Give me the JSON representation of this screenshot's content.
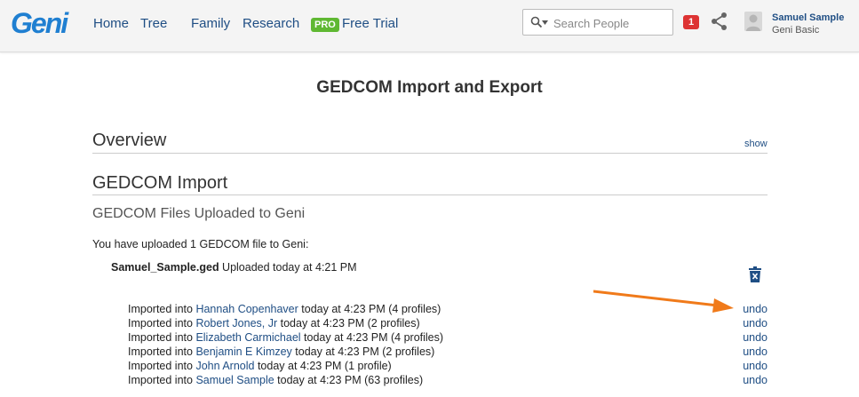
{
  "header": {
    "logo": "Geni",
    "nav": [
      {
        "label": "Home"
      },
      {
        "label": "Tree"
      },
      {
        "label": "Family"
      },
      {
        "label": "Research"
      }
    ],
    "pro_badge": "PRO",
    "free_trial": "Free Trial",
    "search_placeholder": "Search People",
    "notification_count": "1",
    "user": {
      "name": "Samuel Sample",
      "plan": "Geni Basic"
    }
  },
  "page_title": "GEDCOM Import and Export",
  "overview": {
    "heading": "Overview",
    "show_label": "show"
  },
  "import": {
    "heading": "GEDCOM Import",
    "subheading": "GEDCOM Files Uploaded to Geni",
    "uploaded_text": "You have uploaded 1 GEDCOM file to Geni:",
    "file_name": "Samuel_Sample.ged",
    "file_status": " Uploaded today at 4:21 PM",
    "rows": [
      {
        "prefix": "Imported into ",
        "profile": "Hannah Copenhaver",
        "suffix": " today at 4:23 PM (4 profiles)",
        "undo": "undo"
      },
      {
        "prefix": "Imported into ",
        "profile": "Robert Jones, Jr",
        "suffix": " today at 4:23 PM (2 profiles)",
        "undo": "undo"
      },
      {
        "prefix": "Imported into ",
        "profile": "Elizabeth Carmichael",
        "suffix": " today at 4:23 PM (4 profiles)",
        "undo": "undo"
      },
      {
        "prefix": "Imported into ",
        "profile": "Benjamin E Kimzey",
        "suffix": " today at 4:23 PM (2 profiles)",
        "undo": "undo"
      },
      {
        "prefix": "Imported into ",
        "profile": "John Arnold",
        "suffix": " today at 4:23 PM (1 profile)",
        "undo": "undo"
      },
      {
        "prefix": "Imported into ",
        "profile": "Samuel Sample",
        "suffix": " today at 4:23 PM (63 profiles)",
        "undo": "undo"
      }
    ]
  },
  "colors": {
    "brand": "#1f7fd1",
    "link": "#1f4e84",
    "pro": "#5fb832",
    "notification": "#dd3333",
    "arrow": "#f07a1a"
  }
}
